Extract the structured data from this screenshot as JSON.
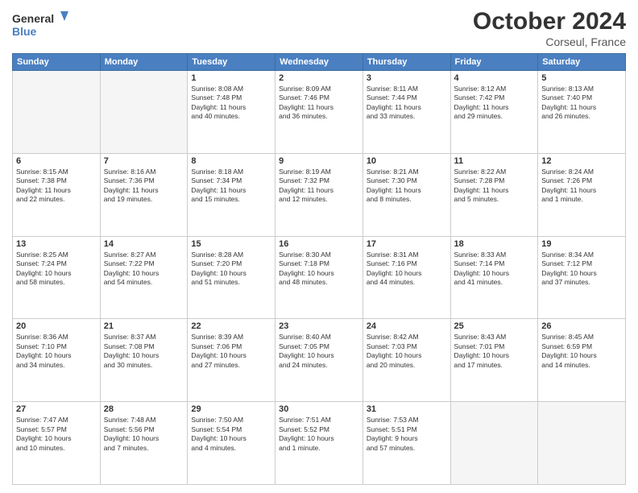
{
  "header": {
    "logo_text_general": "General",
    "logo_text_blue": "Blue",
    "month_title": "October 2024",
    "location": "Corseul, France"
  },
  "weekdays": [
    "Sunday",
    "Monday",
    "Tuesday",
    "Wednesday",
    "Thursday",
    "Friday",
    "Saturday"
  ],
  "weeks": [
    [
      {
        "day": "",
        "info": ""
      },
      {
        "day": "",
        "info": ""
      },
      {
        "day": "1",
        "lines": [
          "Sunrise: 8:08 AM",
          "Sunset: 7:48 PM",
          "Daylight: 11 hours",
          "and 40 minutes."
        ]
      },
      {
        "day": "2",
        "lines": [
          "Sunrise: 8:09 AM",
          "Sunset: 7:46 PM",
          "Daylight: 11 hours",
          "and 36 minutes."
        ]
      },
      {
        "day": "3",
        "lines": [
          "Sunrise: 8:11 AM",
          "Sunset: 7:44 PM",
          "Daylight: 11 hours",
          "and 33 minutes."
        ]
      },
      {
        "day": "4",
        "lines": [
          "Sunrise: 8:12 AM",
          "Sunset: 7:42 PM",
          "Daylight: 11 hours",
          "and 29 minutes."
        ]
      },
      {
        "day": "5",
        "lines": [
          "Sunrise: 8:13 AM",
          "Sunset: 7:40 PM",
          "Daylight: 11 hours",
          "and 26 minutes."
        ]
      }
    ],
    [
      {
        "day": "6",
        "lines": [
          "Sunrise: 8:15 AM",
          "Sunset: 7:38 PM",
          "Daylight: 11 hours",
          "and 22 minutes."
        ]
      },
      {
        "day": "7",
        "lines": [
          "Sunrise: 8:16 AM",
          "Sunset: 7:36 PM",
          "Daylight: 11 hours",
          "and 19 minutes."
        ]
      },
      {
        "day": "8",
        "lines": [
          "Sunrise: 8:18 AM",
          "Sunset: 7:34 PM",
          "Daylight: 11 hours",
          "and 15 minutes."
        ]
      },
      {
        "day": "9",
        "lines": [
          "Sunrise: 8:19 AM",
          "Sunset: 7:32 PM",
          "Daylight: 11 hours",
          "and 12 minutes."
        ]
      },
      {
        "day": "10",
        "lines": [
          "Sunrise: 8:21 AM",
          "Sunset: 7:30 PM",
          "Daylight: 11 hours",
          "and 8 minutes."
        ]
      },
      {
        "day": "11",
        "lines": [
          "Sunrise: 8:22 AM",
          "Sunset: 7:28 PM",
          "Daylight: 11 hours",
          "and 5 minutes."
        ]
      },
      {
        "day": "12",
        "lines": [
          "Sunrise: 8:24 AM",
          "Sunset: 7:26 PM",
          "Daylight: 11 hours",
          "and 1 minute."
        ]
      }
    ],
    [
      {
        "day": "13",
        "lines": [
          "Sunrise: 8:25 AM",
          "Sunset: 7:24 PM",
          "Daylight: 10 hours",
          "and 58 minutes."
        ]
      },
      {
        "day": "14",
        "lines": [
          "Sunrise: 8:27 AM",
          "Sunset: 7:22 PM",
          "Daylight: 10 hours",
          "and 54 minutes."
        ]
      },
      {
        "day": "15",
        "lines": [
          "Sunrise: 8:28 AM",
          "Sunset: 7:20 PM",
          "Daylight: 10 hours",
          "and 51 minutes."
        ]
      },
      {
        "day": "16",
        "lines": [
          "Sunrise: 8:30 AM",
          "Sunset: 7:18 PM",
          "Daylight: 10 hours",
          "and 48 minutes."
        ]
      },
      {
        "day": "17",
        "lines": [
          "Sunrise: 8:31 AM",
          "Sunset: 7:16 PM",
          "Daylight: 10 hours",
          "and 44 minutes."
        ]
      },
      {
        "day": "18",
        "lines": [
          "Sunrise: 8:33 AM",
          "Sunset: 7:14 PM",
          "Daylight: 10 hours",
          "and 41 minutes."
        ]
      },
      {
        "day": "19",
        "lines": [
          "Sunrise: 8:34 AM",
          "Sunset: 7:12 PM",
          "Daylight: 10 hours",
          "and 37 minutes."
        ]
      }
    ],
    [
      {
        "day": "20",
        "lines": [
          "Sunrise: 8:36 AM",
          "Sunset: 7:10 PM",
          "Daylight: 10 hours",
          "and 34 minutes."
        ]
      },
      {
        "day": "21",
        "lines": [
          "Sunrise: 8:37 AM",
          "Sunset: 7:08 PM",
          "Daylight: 10 hours",
          "and 30 minutes."
        ]
      },
      {
        "day": "22",
        "lines": [
          "Sunrise: 8:39 AM",
          "Sunset: 7:06 PM",
          "Daylight: 10 hours",
          "and 27 minutes."
        ]
      },
      {
        "day": "23",
        "lines": [
          "Sunrise: 8:40 AM",
          "Sunset: 7:05 PM",
          "Daylight: 10 hours",
          "and 24 minutes."
        ]
      },
      {
        "day": "24",
        "lines": [
          "Sunrise: 8:42 AM",
          "Sunset: 7:03 PM",
          "Daylight: 10 hours",
          "and 20 minutes."
        ]
      },
      {
        "day": "25",
        "lines": [
          "Sunrise: 8:43 AM",
          "Sunset: 7:01 PM",
          "Daylight: 10 hours",
          "and 17 minutes."
        ]
      },
      {
        "day": "26",
        "lines": [
          "Sunrise: 8:45 AM",
          "Sunset: 6:59 PM",
          "Daylight: 10 hours",
          "and 14 minutes."
        ]
      }
    ],
    [
      {
        "day": "27",
        "lines": [
          "Sunrise: 7:47 AM",
          "Sunset: 5:57 PM",
          "Daylight: 10 hours",
          "and 10 minutes."
        ]
      },
      {
        "day": "28",
        "lines": [
          "Sunrise: 7:48 AM",
          "Sunset: 5:56 PM",
          "Daylight: 10 hours",
          "and 7 minutes."
        ]
      },
      {
        "day": "29",
        "lines": [
          "Sunrise: 7:50 AM",
          "Sunset: 5:54 PM",
          "Daylight: 10 hours",
          "and 4 minutes."
        ]
      },
      {
        "day": "30",
        "lines": [
          "Sunrise: 7:51 AM",
          "Sunset: 5:52 PM",
          "Daylight: 10 hours",
          "and 1 minute."
        ]
      },
      {
        "day": "31",
        "lines": [
          "Sunrise: 7:53 AM",
          "Sunset: 5:51 PM",
          "Daylight: 9 hours",
          "and 57 minutes."
        ]
      },
      {
        "day": "",
        "info": ""
      },
      {
        "day": "",
        "info": ""
      }
    ]
  ]
}
